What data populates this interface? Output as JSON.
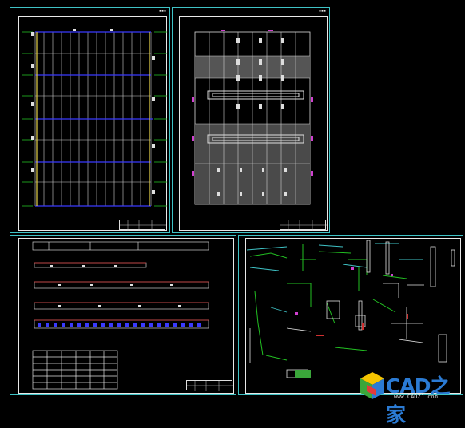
{
  "sheets": [
    {
      "id": "sheet-1",
      "tag": "▪▪▪"
    },
    {
      "id": "sheet-2",
      "tag": "▪▪▪"
    },
    {
      "id": "sheet-3",
      "tag": ""
    },
    {
      "id": "sheet-4",
      "tag": ""
    }
  ],
  "watermark": {
    "main": "CAD之家",
    "sub": "www.CADZJ.com",
    "icon": "cube-logo-icon",
    "icon_colors": [
      "#f5c400",
      "#3aa63a",
      "#2b7bd4",
      "#e23a3a"
    ]
  },
  "colors": {
    "frame": "#3fc3c6",
    "border": "#e8e8e8",
    "grid_white": "#e0e0e0",
    "axis_blue": "#3a3aff",
    "axis_green": "#22c022",
    "yellow": "#e8d44a",
    "magenta": "#d040d0",
    "fill_gray": "#4a4a4a",
    "red": "#d03030"
  }
}
